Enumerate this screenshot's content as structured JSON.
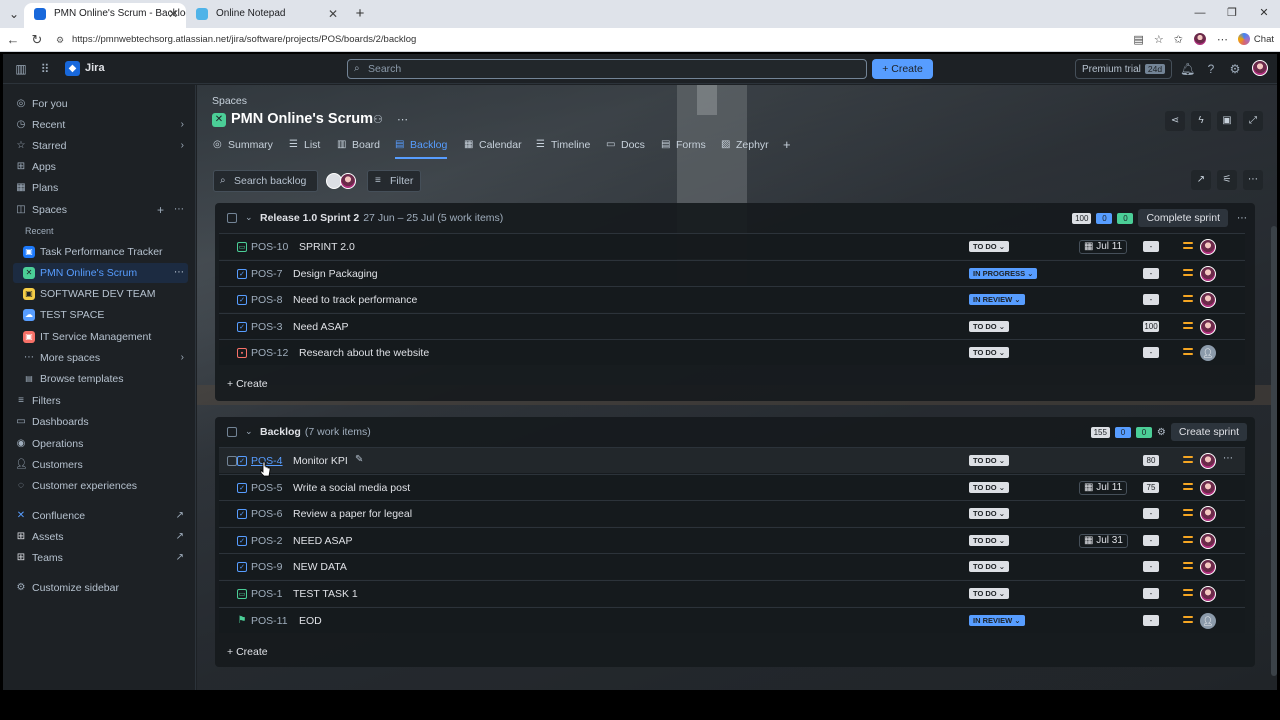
{
  "browser": {
    "tabs": [
      {
        "title": "PMN Online's Scrum - Backlog - Ji",
        "active": true
      },
      {
        "title": "Online Notepad",
        "active": false
      }
    ],
    "url": "https://pmnwebtechsorg.atlassian.net/jira/software/projects/POS/boards/2/backlog",
    "chat_label": "Chat"
  },
  "topnav": {
    "app_name": "Jira",
    "search_placeholder": "Search",
    "create_label": "Create",
    "premium_label": "Premium trial",
    "premium_days": "24d"
  },
  "sidebar": {
    "items": [
      {
        "label": "For you"
      },
      {
        "label": "Recent"
      },
      {
        "label": "Starred"
      },
      {
        "label": "Apps"
      },
      {
        "label": "Plans"
      },
      {
        "label": "Spaces"
      }
    ],
    "recent_label": "Recent",
    "recent_spaces": [
      {
        "label": "Task Performance Tracker",
        "color": "#1d7afc"
      },
      {
        "label": "PMN Online's Scrum",
        "color": "#4bce97"
      },
      {
        "label": "SOFTWARE DEV TEAM",
        "color": "#f5cd47"
      },
      {
        "label": "TEST SPACE",
        "color": "#579dff"
      },
      {
        "label": "IT Service Management",
        "color": "#f87168"
      }
    ],
    "more_spaces": "More spaces",
    "browse_templates": "Browse templates",
    "lower_items": [
      {
        "label": "Filters"
      },
      {
        "label": "Dashboards"
      },
      {
        "label": "Operations"
      },
      {
        "label": "Customers"
      },
      {
        "label": "Customer experiences"
      }
    ],
    "apps_links": [
      {
        "label": "Confluence"
      },
      {
        "label": "Assets"
      },
      {
        "label": "Teams"
      }
    ],
    "customize": "Customize sidebar"
  },
  "project": {
    "breadcrumb": "Spaces",
    "title": "PMN Online's Scrum",
    "tabs": [
      {
        "label": "Summary"
      },
      {
        "label": "List"
      },
      {
        "label": "Board"
      },
      {
        "label": "Backlog"
      },
      {
        "label": "Calendar"
      },
      {
        "label": "Timeline"
      },
      {
        "label": "Docs"
      },
      {
        "label": "Forms"
      },
      {
        "label": "Zephyr"
      }
    ],
    "search_backlog_placeholder": "Search backlog",
    "filter_label": "Filter"
  },
  "sprint": {
    "name": "Release 1.0 Sprint 2",
    "meta": "27 Jun – 25 Jul (5 work items)",
    "counts": [
      "100",
      "0",
      "0"
    ],
    "action_label": "Complete sprint",
    "create_label": "Create",
    "items": [
      {
        "key": "POS-10",
        "summary": "SPRINT 2.0",
        "type": "sub",
        "status": "TO DO",
        "date": "Jul 11",
        "estimate": "-"
      },
      {
        "key": "POS-7",
        "summary": "Design Packaging",
        "type": "task",
        "status": "IN PROGRESS",
        "date": "",
        "estimate": "-"
      },
      {
        "key": "POS-8",
        "summary": "Need to track performance",
        "type": "task",
        "status": "IN REVIEW",
        "date": "",
        "estimate": "-"
      },
      {
        "key": "POS-3",
        "summary": "Need ASAP",
        "type": "task",
        "status": "TO DO",
        "date": "",
        "estimate": "100"
      },
      {
        "key": "POS-12",
        "summary": "Research about the website",
        "type": "bug",
        "status": "TO DO",
        "date": "",
        "estimate": "-"
      }
    ]
  },
  "backlog": {
    "name": "Backlog",
    "meta": "(7 work items)",
    "counts": [
      "155",
      "0",
      "0"
    ],
    "action_label": "Create sprint",
    "create_label": "Create",
    "items": [
      {
        "key": "POS-4",
        "summary": "Monitor KPI",
        "type": "task",
        "status": "TO DO",
        "date": "",
        "estimate": "80"
      },
      {
        "key": "POS-5",
        "summary": "Write a social media post",
        "type": "task",
        "status": "TO DO",
        "date": "Jul 11",
        "estimate": "75"
      },
      {
        "key": "POS-6",
        "summary": "Review a paper for legeal",
        "type": "task",
        "status": "TO DO",
        "date": "",
        "estimate": "-"
      },
      {
        "key": "POS-2",
        "summary": "NEED ASAP",
        "type": "task",
        "status": "TO DO",
        "date": "Jul 31",
        "estimate": "-"
      },
      {
        "key": "POS-9",
        "summary": "NEW DATA",
        "type": "task",
        "status": "TO DO",
        "date": "",
        "estimate": "-"
      },
      {
        "key": "POS-1",
        "summary": "TEST TASK 1",
        "type": "sub",
        "status": "TO DO",
        "date": "",
        "estimate": "-"
      },
      {
        "key": "POS-11",
        "summary": "EOD",
        "type": "story",
        "status": "IN REVIEW",
        "date": "",
        "estimate": "-"
      }
    ]
  }
}
